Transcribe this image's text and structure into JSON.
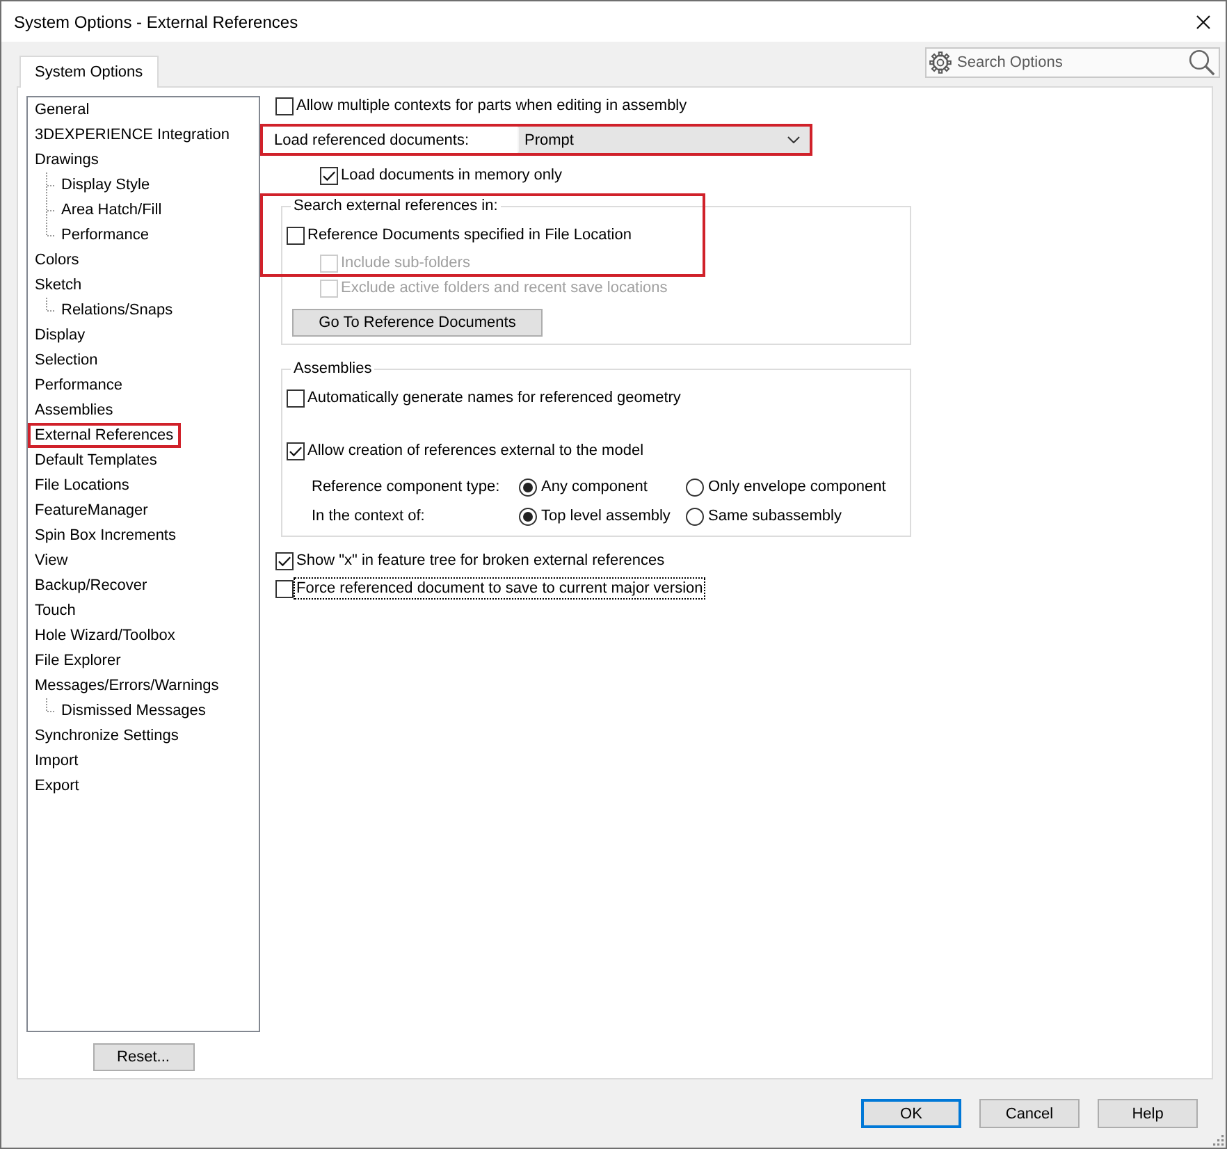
{
  "window": {
    "title": "System Options - External References"
  },
  "tabs": [
    {
      "label": "System Options",
      "selected": true
    }
  ],
  "search": {
    "placeholder": "Search Options"
  },
  "sidebar": {
    "items": [
      {
        "label": "General",
        "highlighted": false
      },
      {
        "label": "3DEXPERIENCE Integration",
        "highlighted": false
      },
      {
        "label": "Drawings",
        "highlighted": false,
        "children": [
          {
            "label": "Display Style",
            "highlighted": false
          },
          {
            "label": "Area Hatch/Fill",
            "highlighted": false
          },
          {
            "label": "Performance",
            "highlighted": false
          }
        ]
      },
      {
        "label": "Colors",
        "highlighted": false
      },
      {
        "label": "Sketch",
        "highlighted": false,
        "children": [
          {
            "label": "Relations/Snaps",
            "highlighted": false
          }
        ]
      },
      {
        "label": "Display",
        "highlighted": false
      },
      {
        "label": "Selection",
        "highlighted": false
      },
      {
        "label": "Performance",
        "highlighted": false
      },
      {
        "label": "Assemblies",
        "highlighted": false
      },
      {
        "label": "External References",
        "highlighted": true
      },
      {
        "label": "Default Templates",
        "highlighted": false
      },
      {
        "label": "File Locations",
        "highlighted": false
      },
      {
        "label": "FeatureManager",
        "highlighted": false
      },
      {
        "label": "Spin Box Increments",
        "highlighted": false
      },
      {
        "label": "View",
        "highlighted": false
      },
      {
        "label": "Backup/Recover",
        "highlighted": false
      },
      {
        "label": "Touch",
        "highlighted": false
      },
      {
        "label": "Hole Wizard/Toolbox",
        "highlighted": false
      },
      {
        "label": "File Explorer",
        "highlighted": false
      },
      {
        "label": "Messages/Errors/Warnings",
        "highlighted": false,
        "children": [
          {
            "label": "Dismissed Messages",
            "highlighted": false
          }
        ]
      },
      {
        "label": "Synchronize Settings",
        "highlighted": false
      },
      {
        "label": "Import",
        "highlighted": false
      },
      {
        "label": "Export",
        "highlighted": false
      }
    ]
  },
  "reset_button": {
    "label": "Reset..."
  },
  "settings": [
    {
      "kind": "checkbox",
      "label": "Allow multiple contexts for parts when editing in assembly",
      "checked": false,
      "disabled": false,
      "focused": false
    },
    {
      "kind": "dropdown",
      "label": "Load referenced documents:",
      "value": "Prompt",
      "highlighted": true,
      "children": [
        {
          "kind": "checkbox",
          "label": "Load documents in memory only",
          "checked": true,
          "disabled": false,
          "focused": false
        }
      ]
    },
    {
      "kind": "group",
      "title": "Search external references in:",
      "highlighted": true,
      "items": [
        {
          "kind": "checkbox",
          "label": "Reference Documents specified in File Location",
          "checked": false,
          "disabled": false,
          "focused": false,
          "children": [
            {
              "kind": "checkbox",
              "label": "Include sub-folders",
              "checked": false,
              "disabled": true,
              "focused": false
            },
            {
              "kind": "checkbox",
              "label": "Exclude active folders and recent save locations",
              "checked": false,
              "disabled": true,
              "focused": false
            }
          ]
        },
        {
          "kind": "button",
          "label": "Go To Reference Documents"
        }
      ]
    },
    {
      "kind": "group",
      "title": "Assemblies",
      "highlighted": false,
      "items": [
        {
          "kind": "checkbox",
          "label": "Automatically generate names for referenced geometry",
          "checked": false,
          "disabled": false,
          "focused": false
        },
        {
          "kind": "checkbox",
          "label": "Allow creation of references external to the model",
          "checked": true,
          "disabled": false,
          "focused": false,
          "children": [
            {
              "kind": "radio_row",
              "label": "Reference component type:",
              "options": [
                {
                  "label": "Any component",
                  "selected": true
                },
                {
                  "label": "Only envelope component",
                  "selected": false
                }
              ]
            },
            {
              "kind": "radio_row",
              "label": "In the context of:",
              "options": [
                {
                  "label": "Top level assembly",
                  "selected": true
                },
                {
                  "label": "Same subassembly",
                  "selected": false
                }
              ]
            }
          ]
        }
      ]
    },
    {
      "kind": "checkbox",
      "label": "Show \"x\" in feature tree for broken external references",
      "checked": true,
      "disabled": false,
      "focused": false
    },
    {
      "kind": "checkbox",
      "label": "Force referenced document to save to current major version",
      "checked": false,
      "disabled": false,
      "focused": true
    }
  ],
  "buttons": [
    {
      "label": "OK",
      "default": true
    },
    {
      "label": "Cancel",
      "default": false
    },
    {
      "label": "Help",
      "default": false
    }
  ]
}
